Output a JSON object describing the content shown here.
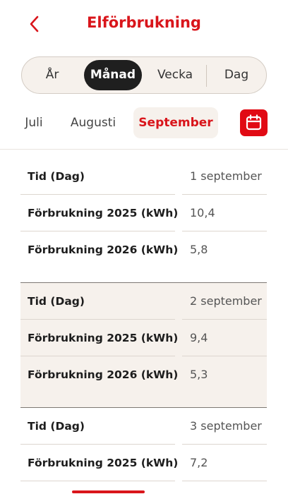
{
  "header": {
    "title": "Elförbrukning"
  },
  "period_tabs": [
    "År",
    "Månad",
    "Vecka",
    "Dag"
  ],
  "period_selected": "Månad",
  "months": [
    "Juli",
    "Augusti",
    "September"
  ],
  "month_selected": "September",
  "accent_color": "#d9151b",
  "icons": {
    "back": "chevron-left-icon",
    "calendar": "calendar-icon"
  },
  "rows": [
    {
      "time_label": "Tid (Dag)",
      "time_value": "1 september",
      "c2025_label": "Förbrukning 2025 (kWh)",
      "c2025_value": "10,4",
      "c2026_label": "Förbrukning 2026 (kWh)",
      "c2026_value": "5,8"
    },
    {
      "time_label": "Tid (Dag)",
      "time_value": "2 september",
      "c2025_label": "Förbrukning 2025 (kWh)",
      "c2025_value": "9,4",
      "c2026_label": "Förbrukning 2026 (kWh)",
      "c2026_value": "5,3"
    },
    {
      "time_label": "Tid (Dag)",
      "time_value": "3 september",
      "c2025_label": "Förbrukning 2025 (kWh)",
      "c2025_value": "7,2"
    }
  ]
}
